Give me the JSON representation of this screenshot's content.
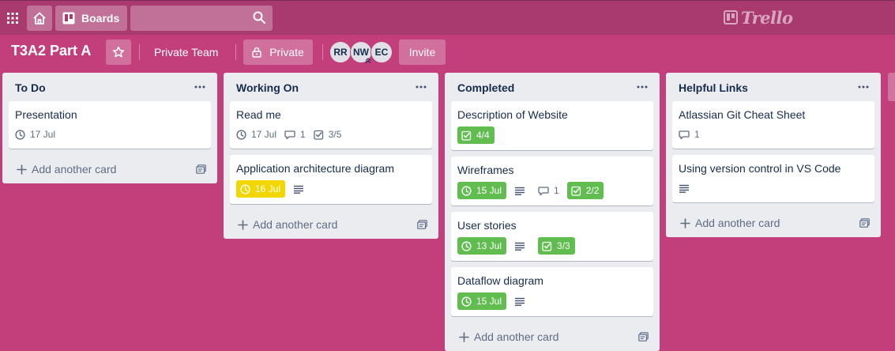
{
  "header": {
    "boards_label": "Boards",
    "search_placeholder": "",
    "logo_text": "Trello"
  },
  "board": {
    "title": "T3A2 Part A",
    "team_label": "Private Team",
    "visibility_label": "Private",
    "members": [
      "RR",
      "NW",
      "EC"
    ],
    "invite_label": "Invite"
  },
  "lists": [
    {
      "title": "To Do",
      "cards": [
        {
          "title": "Presentation",
          "due": "17 Jul"
        }
      ],
      "add_label": "Add another card"
    },
    {
      "title": "Working On",
      "cards": [
        {
          "title": "Read me",
          "due": "17 Jul",
          "comments": "1",
          "checklist": "3/5"
        },
        {
          "title": "Application architecture diagram",
          "due": "16 Jul",
          "due_color": "yellow",
          "has_description": true
        }
      ],
      "add_label": "Add another card"
    },
    {
      "title": "Completed",
      "cards": [
        {
          "title": "Description of Website",
          "checklist": "4/4",
          "checklist_color": "green"
        },
        {
          "title": "Wireframes",
          "due": "15 Jul",
          "due_color": "green",
          "has_description": true,
          "comments": "1",
          "checklist": "2/2",
          "checklist_color": "green"
        },
        {
          "title": "User stories",
          "due": "13 Jul",
          "due_color": "green",
          "has_description": true,
          "checklist": "3/3",
          "checklist_color": "green"
        },
        {
          "title": "Dataflow diagram",
          "due": "15 Jul",
          "due_color": "green",
          "has_description": true
        }
      ],
      "add_label": "Add another card"
    },
    {
      "title": "Helpful Links",
      "cards": [
        {
          "title": "Atlassian Git Cheat Sheet",
          "comments": "1"
        },
        {
          "title": "Using version control in VS Code",
          "has_description": true
        }
      ],
      "add_label": "Add another card"
    }
  ],
  "colors": {
    "board_background": "#c23f7c",
    "header_background": "#a93a6f",
    "list_background": "#ebecf0",
    "due_green": "#61bd4f",
    "due_yellow": "#f2d600"
  },
  "icons": {
    "apps": "grid-icon",
    "home": "home-icon",
    "boards": "boards-icon",
    "search": "search-icon",
    "star": "star-icon",
    "lock": "lock-icon",
    "list_menu": "ellipsis-icon",
    "add": "plus-icon",
    "template": "card-template-icon",
    "due": "clock-icon",
    "comment": "comment-icon",
    "checklist": "checkbox-icon",
    "description": "description-icon"
  }
}
